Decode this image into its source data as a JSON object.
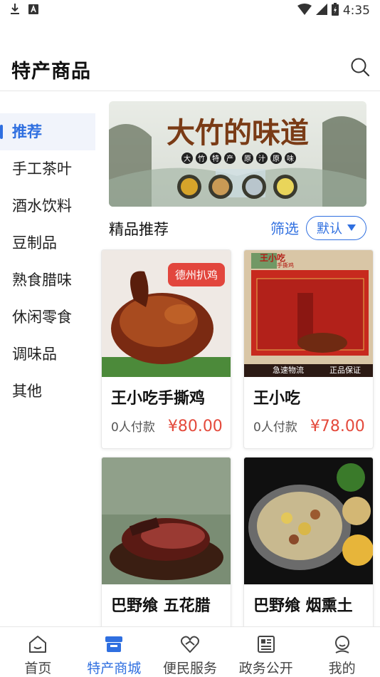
{
  "status_bar": {
    "time": "4:35",
    "icons": [
      "download-icon",
      "a-badge-icon",
      "wifi-icon",
      "signal-icon",
      "battery-icon"
    ]
  },
  "header": {
    "title": "特产商品",
    "search_icon": "search-icon"
  },
  "sidebar": {
    "items": [
      {
        "label": "推荐",
        "active": true
      },
      {
        "label": "手工茶叶"
      },
      {
        "label": "酒水饮料"
      },
      {
        "label": "豆制品"
      },
      {
        "label": "熟食腊味"
      },
      {
        "label": "休闲零食"
      },
      {
        "label": "调味品"
      },
      {
        "label": "其他"
      }
    ]
  },
  "banner": {
    "title": "大竹的味道",
    "tags": [
      "大",
      "竹",
      "特",
      "产",
      "原",
      "汁",
      "原",
      "味"
    ]
  },
  "section": {
    "title": "精品推荐",
    "filter_label": "筛选",
    "sort_label": "默认"
  },
  "products": [
    {
      "name": "王小吃手撕鸡",
      "paid": "0人付款",
      "price": "¥80.00",
      "badge": "德州扒鸡"
    },
    {
      "name": "王小吃",
      "paid": "0人付款",
      "price": "¥78.00",
      "brand": "王小吃",
      "brand_sub": "手撕鸡",
      "strip_left": "急速物流",
      "strip_right": "正品保证"
    },
    {
      "name": "巴野飨 五花腊"
    },
    {
      "name": "巴野飨 烟熏土"
    }
  ],
  "tabbar": {
    "items": [
      {
        "label": "首页",
        "icon": "home-icon"
      },
      {
        "label": "特产商城",
        "icon": "store-icon",
        "active": true
      },
      {
        "label": "便民服务",
        "icon": "heart-hand-icon"
      },
      {
        "label": "政务公开",
        "icon": "newspaper-icon"
      },
      {
        "label": "我的",
        "icon": "profile-icon"
      }
    ]
  },
  "colors": {
    "accent": "#2f6fe0",
    "price": "#e44a3c",
    "badge": "#e2463d"
  }
}
